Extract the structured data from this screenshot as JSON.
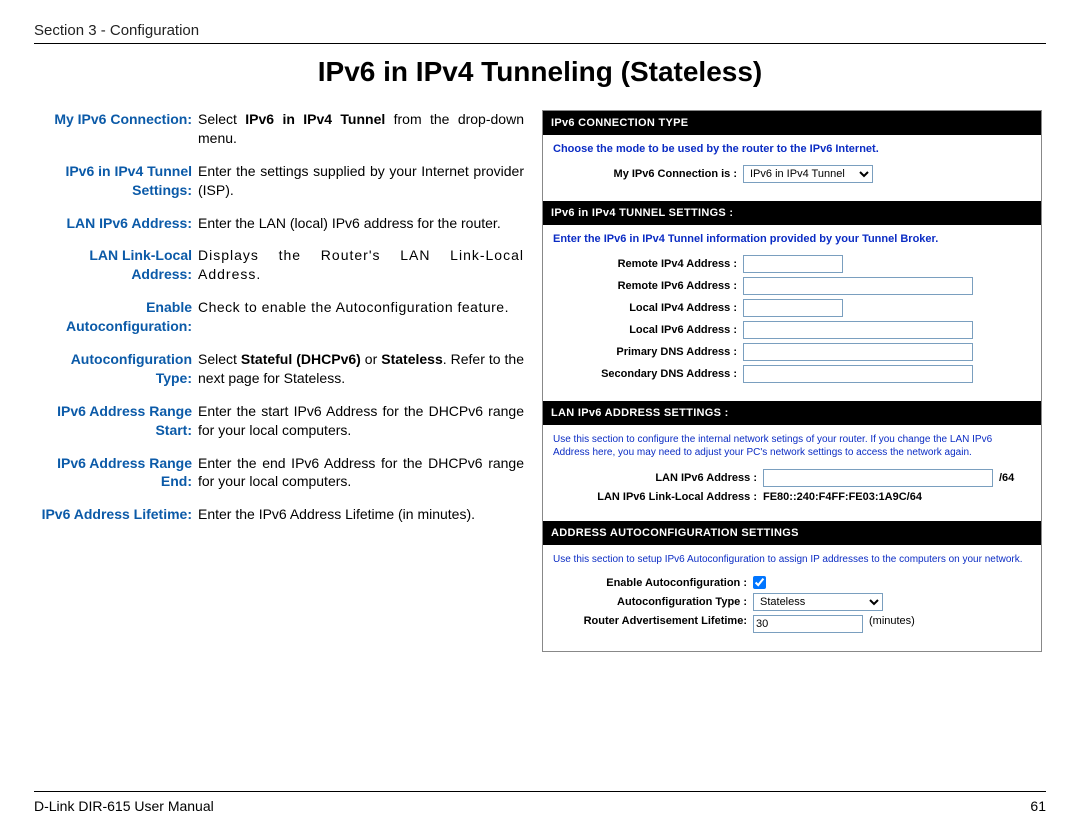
{
  "header": {
    "section": "Section 3 - Configuration"
  },
  "title": "IPv6 in IPv4 Tunneling (Stateless)",
  "definitions": [
    {
      "term": "My IPv6 Connection:",
      "pre": "Select ",
      "bold": "IPv6 in IPv4 Tunnel",
      "post": " from the drop-down menu."
    },
    {
      "term": "IPv6 in IPv4 Tunnel Settings:",
      "desc": "Enter the settings supplied by your Internet provider (ISP)."
    },
    {
      "term": "LAN IPv6 Address:",
      "desc": "Enter the LAN (local) IPv6 address for the router."
    },
    {
      "term": "LAN Link-Local Address:",
      "desc": "Displays the Router's LAN Link-Local Address."
    },
    {
      "term": "Enable Autoconfiguration:",
      "desc": "Check to enable the Autoconfiguration feature."
    },
    {
      "term": "Autoconfiguration Type:",
      "pre": "Select ",
      "bold": "Stateful (DHCPv6)",
      "mid": " or ",
      "bold2": "Stateless",
      "post": ". Refer to the next page for Stateless."
    },
    {
      "term": "IPv6 Address Range Start:",
      "desc": "Enter the start IPv6 Address for the DHCPv6 range for your local computers."
    },
    {
      "term": "IPv6 Address Range End:",
      "desc": "Enter the end IPv6 Address for the DHCPv6 range for your local computers."
    },
    {
      "term": "IPv6 Address Lifetime:",
      "desc": "Enter the IPv6 Address Lifetime (in minutes)."
    }
  ],
  "panel": {
    "sec1": {
      "title": "IPv6 CONNECTION TYPE",
      "instr": "Choose the mode to be used by the router to the IPv6 Internet.",
      "label": "My IPv6 Connection is :",
      "value": "IPv6 in IPv4 Tunnel"
    },
    "sec2": {
      "title": "IPv6 in IPv4 TUNNEL SETTINGS :",
      "instr": "Enter the IPv6 in IPv4 Tunnel information provided by your Tunnel Broker.",
      "rows": [
        "Remote IPv4 Address :",
        "Remote IPv6 Address :",
        "Local IPv4 Address :",
        "Local IPv6 Address :",
        "Primary DNS Address :",
        "Secondary DNS Address :"
      ]
    },
    "sec3": {
      "title": "LAN IPv6 ADDRESS SETTINGS :",
      "instr": "Use this section to configure the internal network setings of your router. If you change the LAN IPv6 Address here, you may need to adjust your PC's network settings to access the network again.",
      "row1_label": "LAN IPv6 Address :",
      "row1_suffix": "/64",
      "row2_label": "LAN IPv6 Link-Local Address :",
      "row2_value": "FE80::240:F4FF:FE03:1A9C/64"
    },
    "sec4": {
      "title": "ADDRESS AUTOCONFIGURATION SETTINGS",
      "instr": "Use this section to setup IPv6 Autoconfiguration to assign IP addresses to the computers on your network.",
      "r1": "Enable Autoconfiguration :",
      "r2": "Autoconfiguration Type :",
      "r2_value": "Stateless",
      "r3": "Router Advertisement Lifetime:",
      "r3_value": "30",
      "r3_suffix": "(minutes)"
    }
  },
  "footer": {
    "manual": "D-Link DIR-615 User Manual",
    "page": "61"
  }
}
